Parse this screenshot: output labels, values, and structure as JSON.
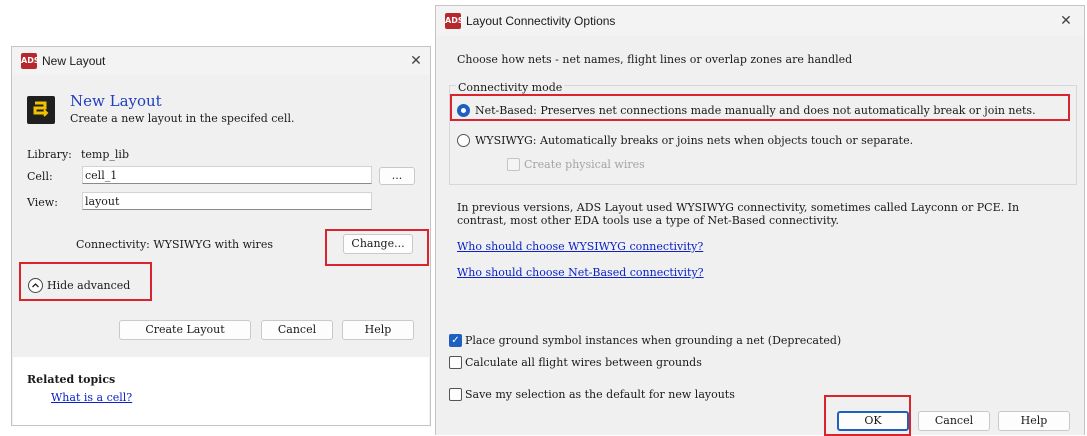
{
  "new_layout": {
    "window_title": "New Layout",
    "heading": "New Layout",
    "subtitle": "Create a new layout in the specifed cell.",
    "library_label": "Library:",
    "library_value": "temp_lib",
    "cell_label": "Cell:",
    "cell_value": "cell_1",
    "browse_label": "...",
    "view_label": "View:",
    "view_value": "layout",
    "connectivity_text": "Connectivity: WYSIWYG with wires",
    "change_label": "Change...",
    "hide_advanced_label": "Hide advanced",
    "create_label": "Create Layout",
    "cancel_label": "Cancel",
    "help_label": "Help",
    "related_title": "Related topics",
    "related_link": "What is a cell?"
  },
  "connectivity_options": {
    "window_title": "Layout Connectivity Options",
    "intro": "Choose how nets - net names, flight lines or overlap zones are handled",
    "group_title": "Connectivity mode",
    "option_net_based": "Net-Based: Preserves net connections made manually and does not automatically break or join nets.",
    "option_wysiwyg": "WYSIWYG: Automatically breaks or joins nets when objects touch or separate.",
    "create_physical_wires": "Create physical wires",
    "selected_mode": "Net-Based",
    "info_line1": "In previous versions, ADS Layout used WYSIWYG connectivity, sometimes called Layconn or PCE. In",
    "info_line2": "contrast, most other EDA tools use a type of Net-Based connectivity.",
    "link_wysiwyg": "Who should choose WYSIWYG connectivity?",
    "link_net_based": "Who should choose Net-Based connectivity?",
    "check_ground": "Place ground symbol instances when grounding a net (Deprecated)",
    "check_ground_state": true,
    "check_flight": "Calculate all flight wires between grounds",
    "check_flight_state": false,
    "check_save": "Save my selection as the default for new layouts",
    "check_save_state": false,
    "ok_label": "OK",
    "cancel_label": "Cancel",
    "help_label": "Help"
  },
  "colors": {
    "highlight_red": "#d9232d",
    "link_blue": "#0a22c8",
    "accent_blue": "#1f5fbf",
    "app_icon_red": "#b7282e",
    "new_layout_icon_yellow": "#f2c200"
  },
  "icons": {
    "app": "ads-logo-icon",
    "new_layout": "new-layout-icon",
    "close": "close-icon",
    "collapse": "chevron-up-circle-icon"
  }
}
